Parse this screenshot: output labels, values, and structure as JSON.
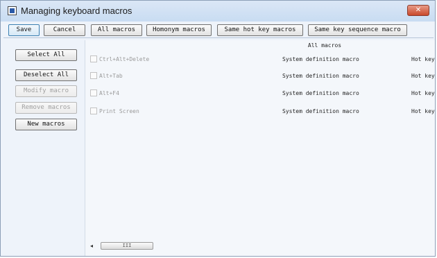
{
  "window": {
    "title": "Managing keyboard macros",
    "close_glyph": "✕"
  },
  "toolbar": {
    "save": "Save",
    "cancel": "Cancel",
    "all_macros": "All macros",
    "homonym_macros": "Homonym macros",
    "same_hot_key_macros": "Same hot key macros",
    "same_key_sequence_macro": "Same key sequence macro"
  },
  "sidebar": {
    "select_all": "Select All",
    "deselect_all": "Deselect All",
    "modify_macro": "Modify macro",
    "remove_macros": "Remove macros",
    "new_macros": "New macros"
  },
  "main": {
    "header": "All macros",
    "rows": [
      {
        "name": "Ctrl+Alt+Delete",
        "type": "System definition macro",
        "hotkey": "Hot key:"
      },
      {
        "name": "Alt+Tab",
        "type": "System definition macro",
        "hotkey": "Hot key:"
      },
      {
        "name": "Alt+F4",
        "type": "System definition macro",
        "hotkey": "Hot key:"
      },
      {
        "name": "Print Screen",
        "type": "System definition macro",
        "hotkey": "Hot key:"
      }
    ]
  },
  "scrollbar": {
    "left_arrow": "◂",
    "thumb_grip": "III"
  },
  "colors": {
    "titlebar": "#c8dcf2",
    "close_button": "#c9492c",
    "default_button_border": "#3c7fb1",
    "disabled_text": "#a0a0a0"
  }
}
